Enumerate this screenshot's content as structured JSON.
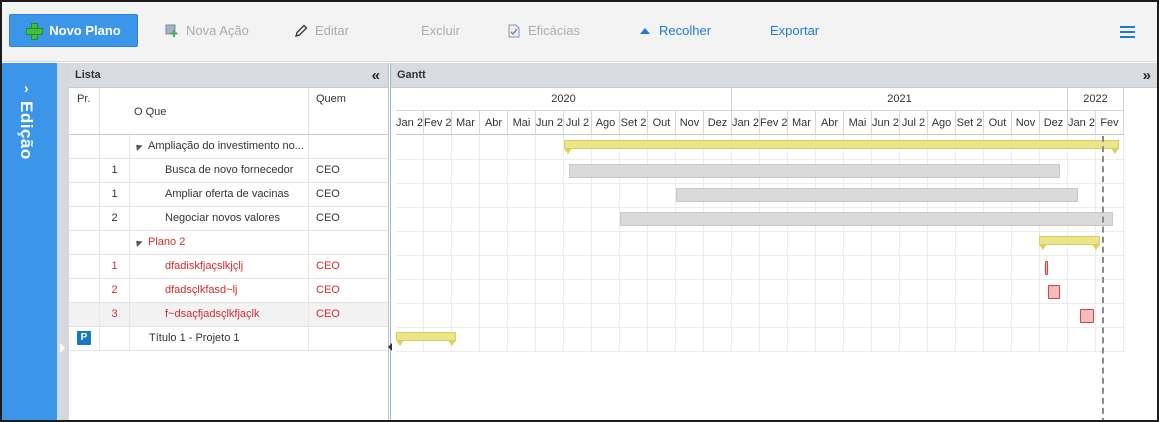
{
  "toolbar": {
    "new_plan": "Novo Plano",
    "new_action": "Nova Ação",
    "edit": "Editar",
    "delete": "Excluir",
    "efficacies": "Eficácias",
    "collapse": "Recolher",
    "export": "Exportar",
    "accent": "#3b95e8",
    "link_color": "#1f7ad6",
    "disabled_color": "#a7adb6"
  },
  "sidebar": {
    "label": "Edição"
  },
  "lista": {
    "title": "Lista",
    "columns": {
      "priority": "Pr.",
      "what": "O Que",
      "who": "Quem"
    },
    "rows": [
      {
        "pr": "",
        "what": "Ampliação do investimento no...",
        "who": "",
        "type": "group"
      },
      {
        "pr": "1",
        "what": "Busca de novo fornecedor",
        "who": "CEO",
        "type": "task"
      },
      {
        "pr": "1",
        "what": "Ampliar oferta de vacinas",
        "who": "CEO",
        "type": "task"
      },
      {
        "pr": "2",
        "what": "Negociar novos valores",
        "who": "CEO",
        "type": "task"
      },
      {
        "pr": "",
        "what": "Plano 2",
        "who": "",
        "type": "group-red"
      },
      {
        "pr": "1",
        "what": "dfadiskfjaçslkjçlj",
        "who": "CEO",
        "type": "task-red"
      },
      {
        "pr": "2",
        "what": "dfadsçlkfasd~lj",
        "who": "CEO",
        "type": "task-red"
      },
      {
        "pr": "3",
        "what": "f~dsaçfjadsçlkfjaçlk",
        "who": "CEO",
        "type": "task-red"
      },
      {
        "pr": "",
        "what": "Título 1 - Projeto 1",
        "who": "",
        "type": "project",
        "badge": "P"
      }
    ]
  },
  "gantt": {
    "title": "Gantt",
    "years": [
      "2020",
      "2021",
      "2022"
    ],
    "months": [
      "Jan 2",
      "Fev 2",
      "Mar",
      "Abr",
      "Mai",
      "Jun 2",
      "Jul 2",
      "Ago",
      "Set 2",
      "Out",
      "Nov",
      "Dez",
      "Jan 2",
      "Fev 2",
      "Mar",
      "Abr",
      "Mai",
      "Jun 2",
      "Jul 2",
      "Ago",
      "Set 2",
      "Out",
      "Nov",
      "Dez",
      "Jan 2",
      "Fev"
    ],
    "colors": {
      "summary": "#ece48a",
      "task": "#dadada",
      "critical": "#f3bcbc"
    }
  }
}
